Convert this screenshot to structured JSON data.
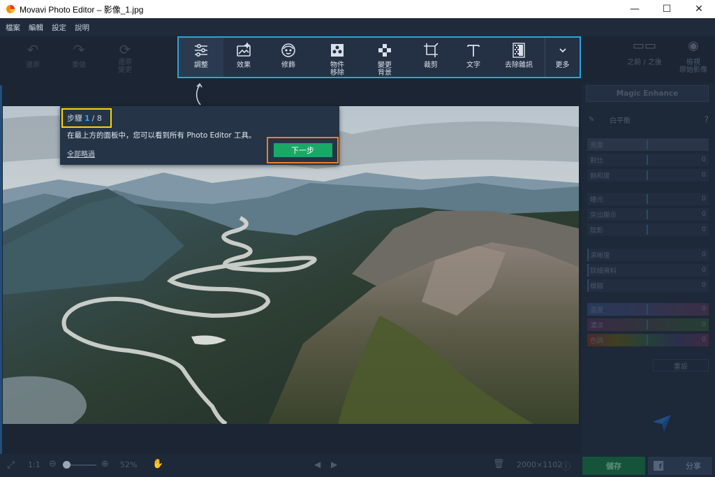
{
  "window": {
    "title": "Movavi Photo Editor – 影像_1.jpg",
    "minimize": "—",
    "maximize": "☐",
    "close": "✕"
  },
  "menu": [
    "檔案",
    "編輯",
    "設定",
    "說明"
  ],
  "undo": [
    {
      "label": "還原",
      "icon": "undo-icon"
    },
    {
      "label": "重做",
      "icon": "redo-icon"
    },
    {
      "label": "還原\n變更",
      "icon": "reset-changes-icon"
    }
  ],
  "tools": [
    {
      "label": "調整",
      "icon": "sliders-icon",
      "active": true
    },
    {
      "label": "效果",
      "icon": "effects-icon"
    },
    {
      "label": "修飾",
      "icon": "retouch-face-icon"
    },
    {
      "label": "物件\n移除",
      "icon": "object-removal-icon"
    },
    {
      "label": "變更\n背景",
      "icon": "change-background-icon"
    },
    {
      "label": "裁剪",
      "icon": "crop-icon"
    },
    {
      "label": "文字",
      "icon": "text-icon"
    },
    {
      "label": "去除雜訊",
      "icon": "denoise-icon"
    },
    {
      "label": "更多",
      "icon": "chevron-down-icon"
    }
  ],
  "right_tools": [
    {
      "label": "之前 / 之後",
      "icon": "before-after-icon"
    },
    {
      "label": "檢視\n原始影像",
      "icon": "eye-icon"
    }
  ],
  "tour": {
    "step_prefix": "步驟",
    "step_current": "1",
    "step_sep": "/ 8",
    "message": "在最上方的面板中，您可以看到所有 Photo Editor 工具。",
    "skip": "全部略過",
    "next": "下一步"
  },
  "panel": {
    "magic": "Magic Enhance",
    "white_balance": "白平衡",
    "help": "?",
    "sliders": [
      {
        "label": "亮度",
        "value": ""
      },
      {
        "label": "對比",
        "value": "0"
      },
      {
        "label": "飽和度",
        "value": "0"
      },
      {
        "label": "曝光",
        "value": "0"
      },
      {
        "label": "突出顯示",
        "value": "0"
      },
      {
        "label": "陰影",
        "value": "0"
      },
      {
        "label": "清晰度",
        "value": "0"
      },
      {
        "label": "詳細資料",
        "value": "0"
      },
      {
        "label": "模糊",
        "value": "0"
      },
      {
        "label": "溫度",
        "value": "0"
      },
      {
        "label": "濃淡",
        "value": "0"
      },
      {
        "label": "色調",
        "value": "0"
      }
    ],
    "reset": "重設"
  },
  "bottom": {
    "fit": "⤢",
    "one_to_one": "1:1",
    "zoom": "52%",
    "size": "2000×1102",
    "save": "儲存",
    "share": "分享"
  },
  "colors": {
    "accent": "#27a6d9",
    "step_highlight": "#ffd400",
    "next_highlight": "#f07f22",
    "next_btn": "#1aa866"
  }
}
